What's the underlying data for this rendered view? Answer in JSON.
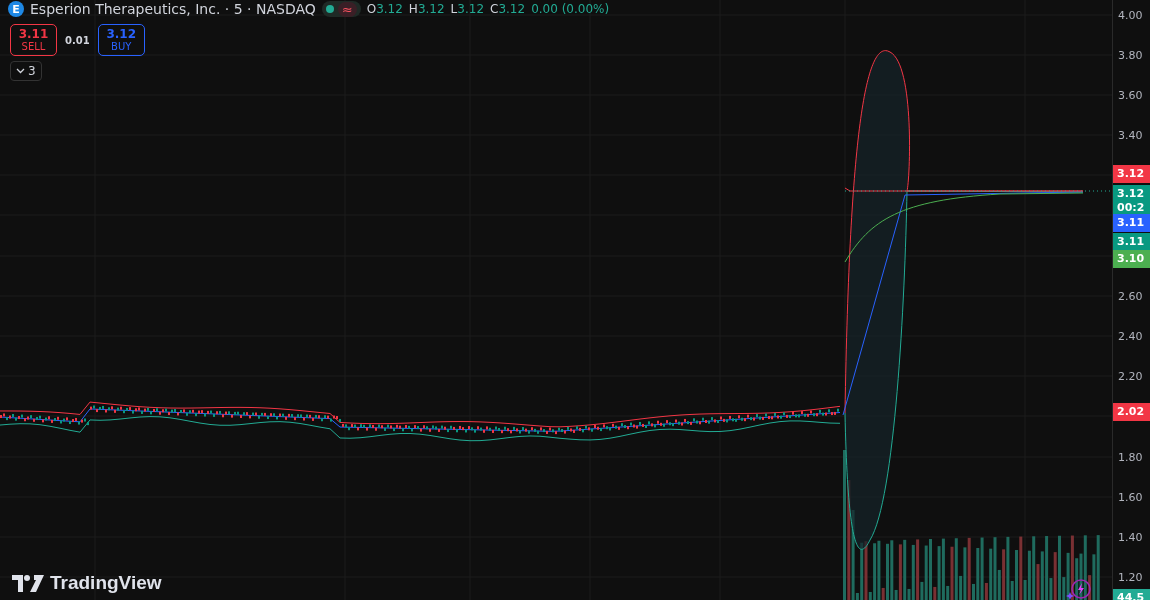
{
  "legend": {
    "logo_letter": "E",
    "title": "Esperion Therapeutics, Inc. · 5 · NASDAQ",
    "market_open": true,
    "delayed_symbol": "≈",
    "ohlc": [
      {
        "label": "O",
        "value": "3.12"
      },
      {
        "label": "H",
        "value": "3.12"
      },
      {
        "label": "L",
        "value": "3.12"
      },
      {
        "label": "C",
        "value": "3.12"
      }
    ],
    "change": "0.00 (0.00%)"
  },
  "trade": {
    "sell": {
      "price": "3.11",
      "label": "SELL"
    },
    "spread": "0.01",
    "buy": {
      "price": "3.12",
      "label": "BUY"
    }
  },
  "indicators_toggle": {
    "count": "3",
    "expanded": false
  },
  "price_axis": [
    {
      "kind": "tick",
      "text": "4.00"
    },
    {
      "kind": "tick",
      "text": "3.80"
    },
    {
      "kind": "tick",
      "text": "3.60"
    },
    {
      "kind": "tick",
      "text": "3.40"
    },
    {
      "kind": "badge",
      "text": "3.12",
      "color": "#f23645"
    },
    {
      "kind": "badge",
      "text": "3.12",
      "sub": "00:2",
      "color": "#089981"
    },
    {
      "kind": "badge",
      "text": "3.11",
      "color": "#2962ff"
    },
    {
      "kind": "badge",
      "text": "3.11",
      "color": "#089981"
    },
    {
      "kind": "badge",
      "text": "3.10",
      "color": "#4caf50"
    },
    {
      "kind": "tick",
      "text": "2.60"
    },
    {
      "kind": "tick",
      "text": "2.40"
    },
    {
      "kind": "tick",
      "text": "2.20"
    },
    {
      "kind": "badge",
      "text": "2.02",
      "color": "#f23645"
    },
    {
      "kind": "tick",
      "text": "1.80"
    },
    {
      "kind": "tick",
      "text": "1.60"
    },
    {
      "kind": "tick",
      "text": "1.40"
    },
    {
      "kind": "tick",
      "text": "1.20"
    },
    {
      "kind": "badge",
      "text": "44.5",
      "color": "#22ab94"
    }
  ],
  "brand": "TradingView"
}
